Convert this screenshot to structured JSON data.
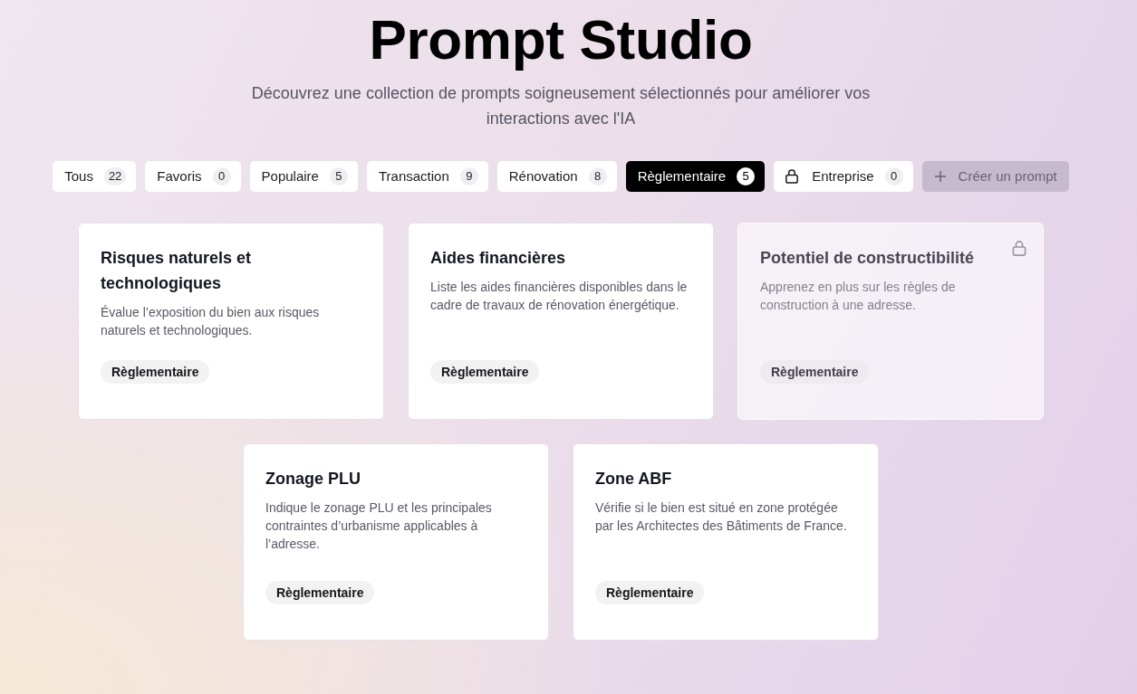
{
  "header": {
    "title": "Prompt Studio",
    "subtitle": "Découvrez une collection de prompts soigneusement sélectionnés pour améliorer vos interactions avec l'IA"
  },
  "tabs": [
    {
      "label": "Tous",
      "count": "22",
      "selected": false,
      "locked": false
    },
    {
      "label": "Favoris",
      "count": "0",
      "selected": false,
      "locked": false
    },
    {
      "label": "Populaire",
      "count": "5",
      "selected": false,
      "locked": false
    },
    {
      "label": "Transaction",
      "count": "9",
      "selected": false,
      "locked": false
    },
    {
      "label": "Rénovation",
      "count": "8",
      "selected": false,
      "locked": false
    },
    {
      "label": "Règlementaire",
      "count": "5",
      "selected": true,
      "locked": false
    },
    {
      "label": "Entreprise",
      "count": "0",
      "selected": false,
      "locked": true
    }
  ],
  "create_button": {
    "label": "Créer un prompt",
    "disabled": true
  },
  "cards": [
    {
      "title": "Risques naturels et technologiques",
      "description": "Évalue l’exposition du bien aux risques naturels et technologiques.",
      "tag": "Règlementaire",
      "locked": false
    },
    {
      "title": "Aides financières",
      "description": "Liste les aides financières disponibles dans le cadre de travaux de rénovation énergétique.",
      "tag": "Règlementaire",
      "locked": false
    },
    {
      "title": "Potentiel de constructibilité",
      "description": "Apprenez en plus sur les règles de construction à une adresse.",
      "tag": "Règlementaire",
      "locked": true
    },
    {
      "title": "Zonage PLU",
      "description": "Indique le zonage PLU et les principales contraintes d’urbanisme applicables à l’adresse.",
      "tag": "Règlementaire",
      "locked": false
    },
    {
      "title": "Zone ABF",
      "description": "Vérifie si le bien est situé en zone protégée par les Architectes des Bâtiments de France.",
      "tag": "Règlementaire",
      "locked": false
    }
  ]
}
